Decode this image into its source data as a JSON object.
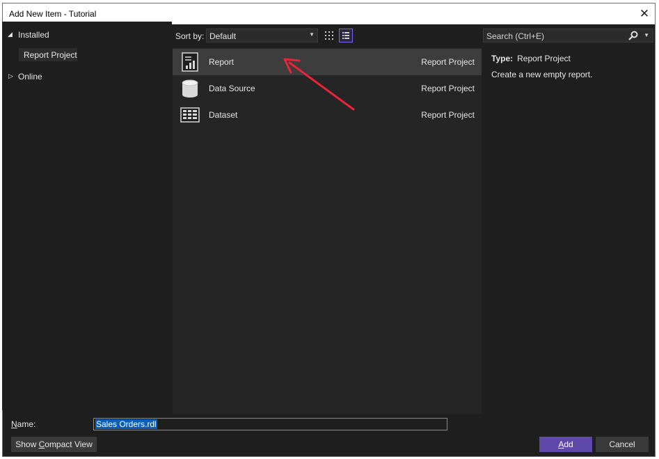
{
  "window": {
    "title": "Add New Item - Tutorial"
  },
  "tree": {
    "installed": "Installed",
    "report_project": "Report Project",
    "online": "Online"
  },
  "toolbar": {
    "sort_label": "Sort by:",
    "sort_value": "Default",
    "search_placeholder": "Search (Ctrl+E)"
  },
  "items": [
    {
      "name": "Report",
      "category": "Report Project",
      "icon": "report-icon",
      "selected": true
    },
    {
      "name": "Data Source",
      "category": "Report Project",
      "icon": "data-source-icon",
      "selected": false
    },
    {
      "name": "Dataset",
      "category": "Report Project",
      "icon": "dataset-icon",
      "selected": false
    }
  ],
  "details": {
    "type_label": "Type:",
    "type_value": "Report Project",
    "description": "Create a new empty report."
  },
  "footer": {
    "name_label": "Name:",
    "name_value": "Sales Orders.rdl",
    "compact_view_label": "Show Compact View",
    "add_label": "Add",
    "cancel_label": "Cancel"
  },
  "colors": {
    "accent": "#5d47a8",
    "annotation_arrow": "#e8253a",
    "selection": "#0a5eb8"
  }
}
